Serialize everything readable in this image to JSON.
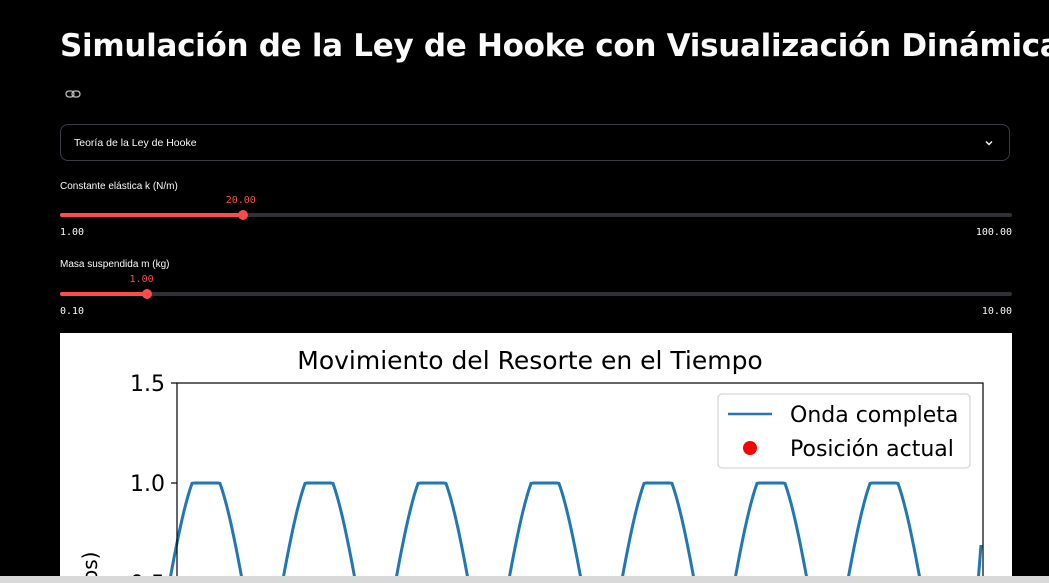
{
  "page": {
    "title": "Simulación de la Ley de Hooke con Visualización Dinámica",
    "emoji_icon": "technologist-icon",
    "link_icon": "link-icon"
  },
  "expander": {
    "label": "Teoría de la Ley de Hooke",
    "icon": "chevron-down-icon"
  },
  "sliders": [
    {
      "label": "Constante elástica k (N/m)",
      "value": "20.00",
      "min": "1.00",
      "max": "100.00",
      "fraction": 0.1919
    },
    {
      "label": "Masa suspendida m (kg)",
      "value": "1.00",
      "min": "0.10",
      "max": "10.00",
      "fraction": 0.0909
    }
  ],
  "colors": {
    "accent": "#ff4b4b",
    "background": "#000000",
    "series": "#1f77b4",
    "marker": "#ff0000"
  },
  "chart_data": {
    "type": "line",
    "title": "Movimiento del Resorte en el Tiempo",
    "ylabel_visible": "os)",
    "yticks": [
      "1.5",
      "1.0",
      "0.5"
    ],
    "ylim": [
      0.35,
      1.5
    ],
    "legend_position": "upper right",
    "series": [
      {
        "name": "Onda completa",
        "style": "line"
      },
      {
        "name": "Posición actual",
        "style": "point"
      }
    ],
    "peaks": [
      1.0,
      1.0,
      1.0,
      1.0,
      1.0,
      1.0,
      1.0
    ],
    "period_s": 1.405,
    "x_start": 0.0,
    "x_end": 10.0
  }
}
